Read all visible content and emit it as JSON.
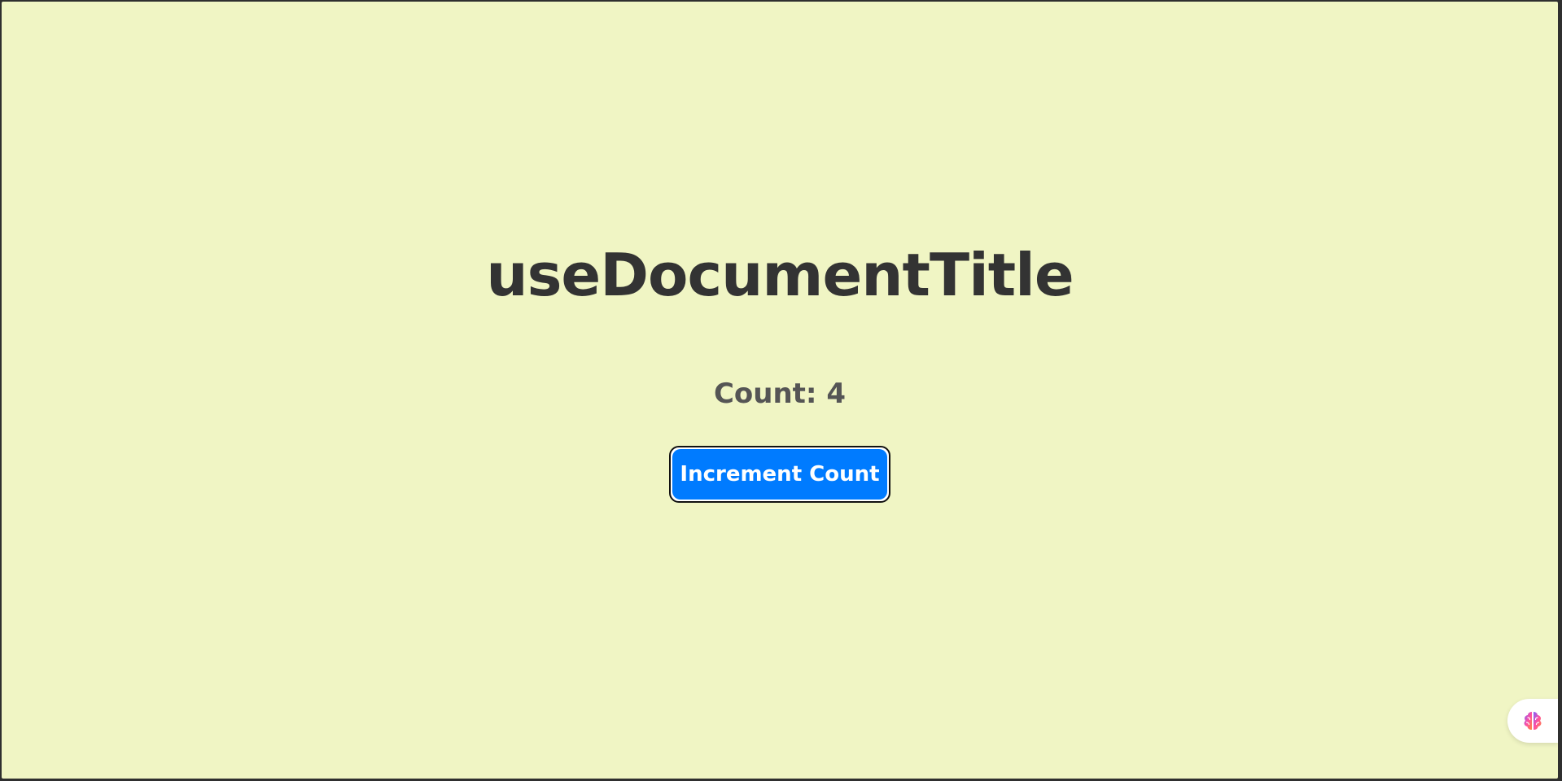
{
  "main": {
    "title": "useDocumentTitle",
    "count_label": "Count: 4",
    "button_label": "Increment Count"
  },
  "floating": {
    "icon": "brain-icon"
  },
  "colors": {
    "background": "#f0f5c4",
    "button": "#007bff",
    "title_text": "#333333",
    "count_text": "#555555"
  }
}
